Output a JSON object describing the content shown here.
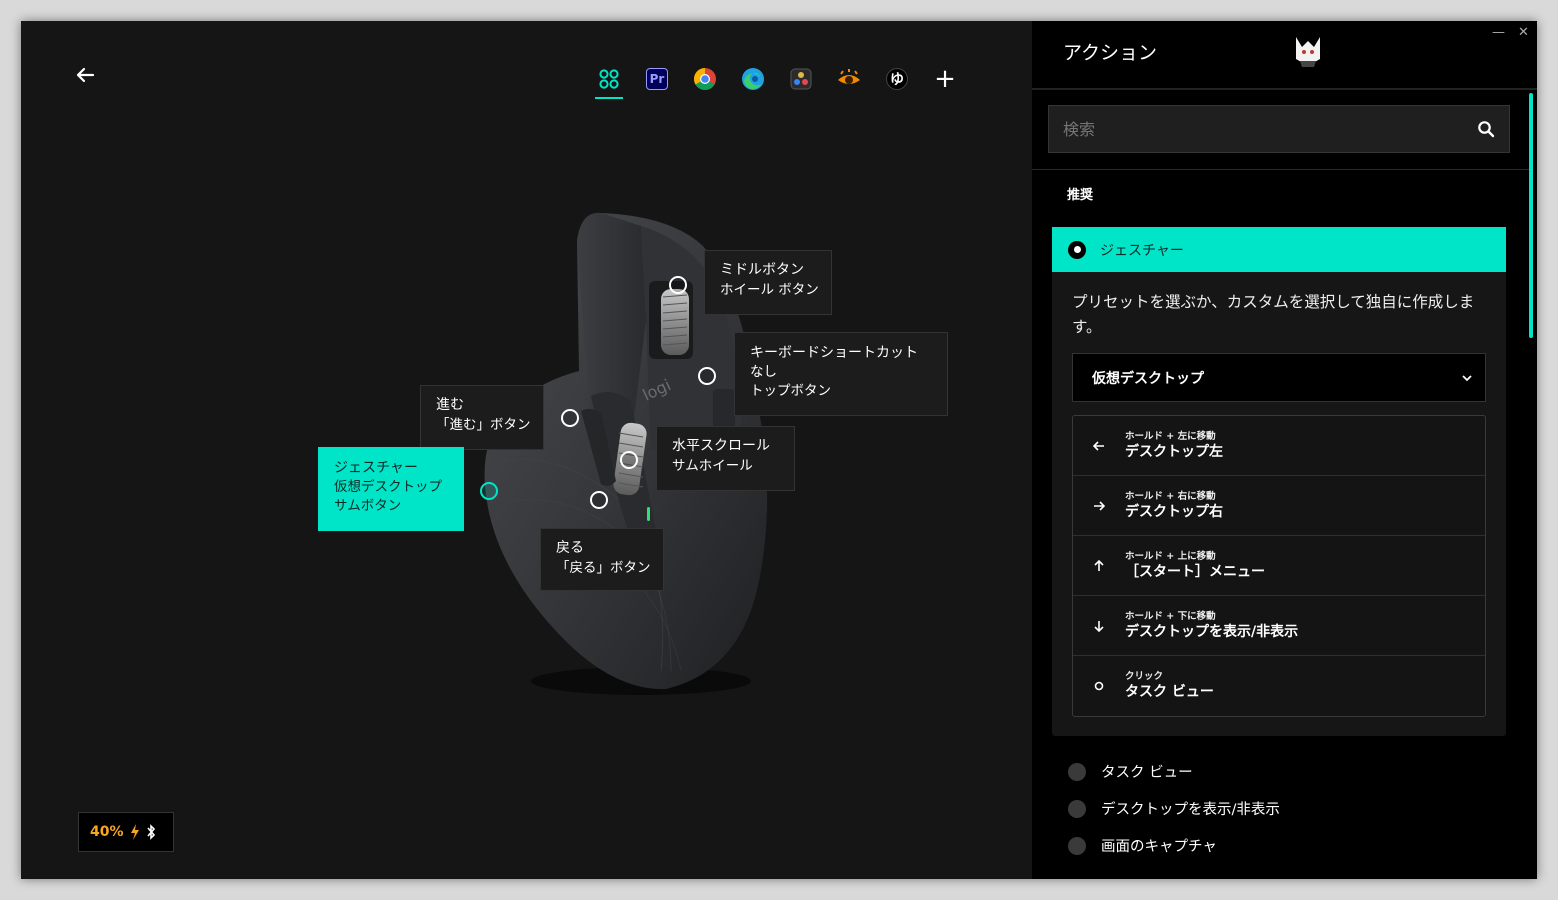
{
  "apps": [
    {
      "name": "all-apps",
      "label": "",
      "color": "#00e5c8"
    },
    {
      "name": "premiere-pro",
      "label": "Pr",
      "color": "#9999ff"
    },
    {
      "name": "chrome",
      "label": "",
      "color": "#34a853"
    },
    {
      "name": "edge",
      "label": "",
      "color": "#1fa2e2"
    },
    {
      "name": "davinci-resolve",
      "label": "",
      "color": "#e0b84a"
    },
    {
      "name": "app-6",
      "label": "",
      "color": "#f08a00"
    },
    {
      "name": "app-7",
      "label": "ゆ",
      "color": "#ffffff"
    },
    {
      "name": "add-app",
      "label": "+",
      "color": "#ffffff"
    }
  ],
  "callouts": {
    "middle": {
      "line1": "ミドルボタン",
      "line2": "ホイール ボタン"
    },
    "top": {
      "line1": "キーボードショートカット",
      "line2": "なし",
      "line3": "トップボタン"
    },
    "forward": {
      "line1": "進む",
      "line2": "「進む」ボタン"
    },
    "hscroll": {
      "line1": "水平スクロール",
      "line2": "サムホイール"
    },
    "gesture": {
      "line1": "ジェスチャー",
      "line2": "仮想デスクトップ",
      "line3": "サムボタン"
    },
    "back": {
      "line1": "戻る",
      "line2": "「戻る」ボタン"
    }
  },
  "battery": {
    "percent": "40%"
  },
  "panel": {
    "title": "アクション",
    "search_placeholder": "検索",
    "recommended_label": "推奨",
    "selected": {
      "title": "ジェスチャー",
      "description": "プリセットを選ぶか、カスタムを選択して独自に作成します。",
      "preset": "仮想デスクトップ",
      "gestures": [
        {
          "hint": "ホールド + 左に移動",
          "action": "デスクトップ左",
          "icon": "arrow-left-icon"
        },
        {
          "hint": "ホールド + 右に移動",
          "action": "デスクトップ右",
          "icon": "arrow-right-icon"
        },
        {
          "hint": "ホールド + 上に移動",
          "action": "［スタート］メニュー",
          "icon": "arrow-up-icon"
        },
        {
          "hint": "ホールド + 下に移動",
          "action": "デスクトップを表示/非表示",
          "icon": "arrow-down-icon"
        },
        {
          "hint": "クリック",
          "action": "タスク ビュー",
          "icon": "circle-icon"
        }
      ]
    },
    "options": [
      {
        "label": "タスク ビュー"
      },
      {
        "label": "デスクトップを表示/非表示"
      },
      {
        "label": "画面のキャプチャ"
      }
    ]
  },
  "colors": {
    "accent": "#00e5c8",
    "battery": "#f5a623"
  }
}
